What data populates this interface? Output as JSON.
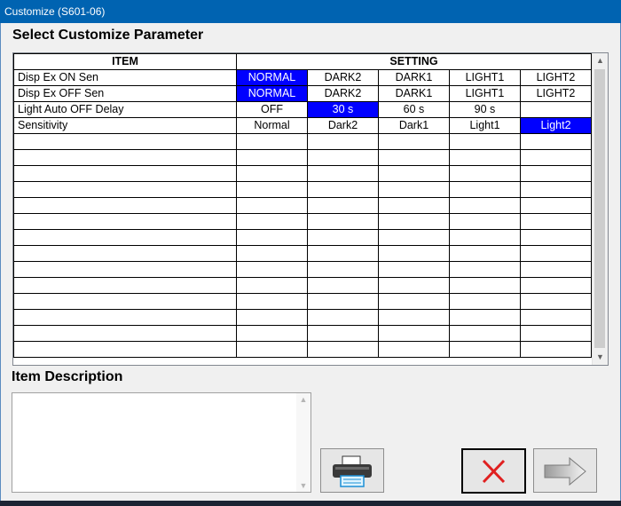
{
  "window": {
    "title": "Customize (S601-06)"
  },
  "params": {
    "heading": "Select Customize Parameter",
    "columns": {
      "item": "ITEM",
      "setting": "SETTING"
    },
    "rows": [
      {
        "item": "Disp Ex ON Sen",
        "settings": [
          "NORMAL",
          "DARK2",
          "DARK1",
          "LIGHT1",
          "LIGHT2"
        ],
        "selected": 0
      },
      {
        "item": "Disp Ex OFF Sen",
        "settings": [
          "NORMAL",
          "DARK2",
          "DARK1",
          "LIGHT1",
          "LIGHT2"
        ],
        "selected": 0
      },
      {
        "item": "Light Auto OFF Delay",
        "settings": [
          "OFF",
          "30 s",
          "60 s",
          "90 s",
          ""
        ],
        "selected": 1
      },
      {
        "item": "Sensitivity",
        "settings": [
          "Normal",
          "Dark2",
          "Dark1",
          "Light1",
          "Light2"
        ],
        "selected": 4
      }
    ],
    "empty_rows": 14
  },
  "description": {
    "heading": "Item Description",
    "text": ""
  },
  "colors": {
    "selected_bg": "#0000ff",
    "selected_fg": "#ffffff",
    "titlebar": "#0063b1"
  },
  "buttons": {
    "print": {
      "icon": "printer-icon"
    },
    "cancel": {
      "icon": "red-x-icon"
    },
    "next": {
      "icon": "right-arrow-icon"
    }
  }
}
